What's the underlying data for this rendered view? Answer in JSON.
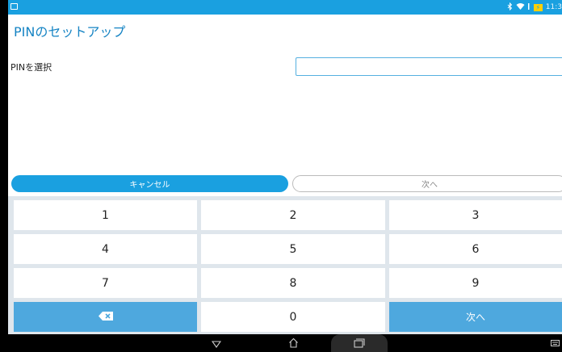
{
  "status_bar": {
    "time": "11:3"
  },
  "header": {
    "title": "PINのセットアップ"
  },
  "form": {
    "pin_label": "PINを選択",
    "pin_value": ""
  },
  "actions": {
    "cancel_label": "キャンセル",
    "next_label": "次へ"
  },
  "keypad": {
    "keys": [
      "1",
      "2",
      "3",
      "4",
      "5",
      "6",
      "7",
      "8",
      "9",
      "0"
    ],
    "enter_label": "次へ"
  },
  "colors": {
    "accent": "#1aa0e0",
    "title": "#1684c4",
    "key_blue": "#4ea8de",
    "keypad_bg": "#dfe6ec"
  }
}
